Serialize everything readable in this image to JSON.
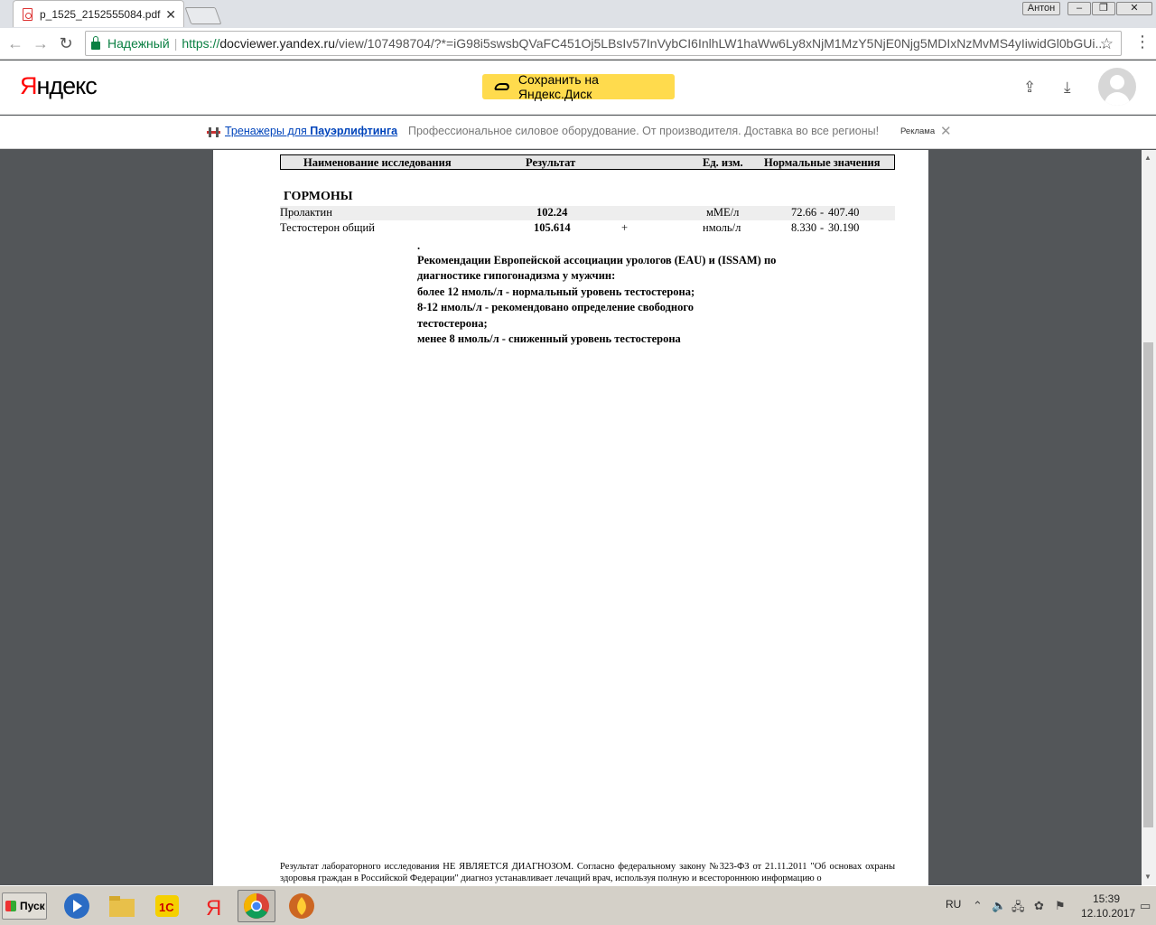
{
  "browser": {
    "tab_title": "p_1525_2152555084.pdf",
    "user_name": "Антон",
    "security_label": "Надежный",
    "url_scheme": "https://",
    "url_host": "docviewer.yandex.ru",
    "url_path": "/view/107498704/?*=iG98i5swsbQVaFC451Oj5LBsIv57InVybCI6InlhLW1haWw6Ly8xNjM1MzY5NjE0Njg5MDIxNzMvMS4yIiwidGl0bGUi..."
  },
  "header": {
    "logo_first": "Я",
    "logo_rest": "ндекс",
    "save_button": "Сохранить на Яндекс.Диск"
  },
  "ad": {
    "link_text": "Тренажеры для ",
    "link_bold": "Пауэрлифтинга",
    "text": "Профессиональное силовое оборудование. От производителя. Доставка во все регионы!",
    "label": "Реклама"
  },
  "document": {
    "columns": [
      "Наименование исследования",
      "Результат",
      "Ед. изм.",
      "Нормальные значения"
    ],
    "section": "ГОРМОНЫ",
    "rows": [
      {
        "name": "Пролактин",
        "result": "102.24",
        "flag": "",
        "unit": "мМЕ/л",
        "norm_low": "72.66",
        "norm_high": "407.40"
      },
      {
        "name": "Тестостерон общий",
        "result": "105.614",
        "flag": "+",
        "unit": "нмоль/л",
        "norm_low": "8.330",
        "norm_high": "30.190"
      }
    ],
    "dash": "-",
    "note_lines": [
      ".",
      "Рекомендации Европейской ассоциации урологов (EAU) и (ISSAM) по",
      "диагностике гипогонадизма у мужчин:",
      "более 12 нмоль/л - нормальный уровень тестостерона;",
      "8-12 нмоль/л - рекомендовано определение свободного",
      "тестостерона;",
      "менее 8 нмоль/л - сниженный уровень тестостерона"
    ],
    "footer": "Результат лабораторного исследования НЕ ЯВЛЯЕТСЯ ДИАГНОЗОМ. Согласно федеральному закону №323-ФЗ от 21.11.2011 \"Об основах охраны здоровья граждан в Российской Федерации\" диагноз устанавливает лечащий врач, используя полную и всестороннюю информацию о"
  },
  "taskbar": {
    "start_label": "Пуск",
    "language": "RU",
    "time": "15:39",
    "date": "12.10.2017"
  },
  "colors": {
    "accent_yellow": "#ffdb4d",
    "secure_green": "#0b8043",
    "link_blue": "#0044bb",
    "viewer_bg": "#535659"
  }
}
